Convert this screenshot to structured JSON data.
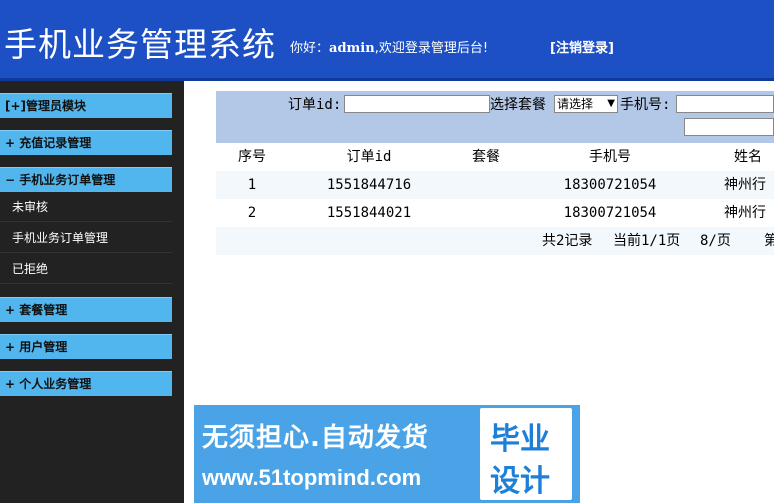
{
  "header": {
    "title": "手机业务管理系统",
    "greeting_prefix": "你好：",
    "username": "admin",
    "greeting_suffix": ",欢迎登录管理后台!",
    "logout": "[注销登录]"
  },
  "sidebar": {
    "groups": [
      {
        "label": "[+]管理员模块"
      },
      {
        "label": "+ 充值记录管理"
      },
      {
        "label": "− 手机业务订单管理"
      },
      {
        "label": "+ 套餐管理"
      },
      {
        "label": "+ 用户管理"
      },
      {
        "label": "+ 个人业务管理"
      }
    ],
    "subitems": [
      {
        "label": "未审核"
      },
      {
        "label": "手机业务订单管理"
      },
      {
        "label": "已拒绝"
      }
    ]
  },
  "search": {
    "order_id_label": "订单id:",
    "order_id_value": "",
    "package_label": "选择套餐",
    "package_selected": "请选择",
    "phone_label": "手机号:",
    "phone_value": ""
  },
  "table": {
    "columns": [
      "序号",
      "订单id",
      "套餐",
      "手机号",
      "姓名"
    ],
    "rows": [
      {
        "no": "1",
        "order_id": "1551844716",
        "package": "",
        "phone": "18300721054",
        "name": "神州行"
      },
      {
        "no": "2",
        "order_id": "1551844021",
        "package": "",
        "phone": "18300721054",
        "name": "神州行"
      }
    ]
  },
  "pagination": {
    "total": "共2记录",
    "current": "当前1/1页",
    "per_page": "8/页",
    "first": "第"
  },
  "ad": {
    "slogan": "无须担心.自动发货",
    "url": "www.51topmind.com",
    "badge_line1": "毕业",
    "badge_line2": "设计"
  },
  "colors": {
    "header_bg": "#1d50c4",
    "sidebar_bg": "#222222",
    "sidebar_group_bg": "#52b6ee",
    "search_bar_bg": "#b3c7e6",
    "row_alt_bg": "#f2f8fc"
  }
}
